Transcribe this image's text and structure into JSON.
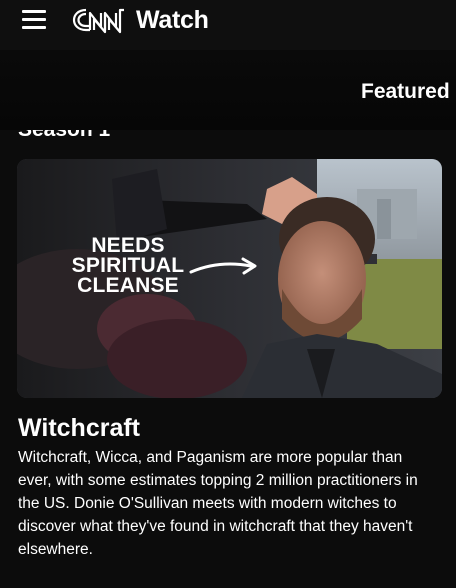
{
  "header": {
    "brand_logo": "CNN",
    "brand_suffix": "Watch",
    "menu_icon": "hamburger-menu-icon"
  },
  "subnav": {
    "active_tab": "Featured"
  },
  "main": {
    "season_heading": "Season 1",
    "hero": {
      "overlay_lines": [
        "NEEDS",
        "SPIRITUAL",
        "CLEANSE"
      ],
      "arrow_icon": "arrow-right-icon"
    },
    "episode_title": "Witchcraft",
    "episode_description": "Witchcraft, Wicca, and Paganism are more popular than ever, with some estimates topping 2 million practitioners in the US. Donie O'Sullivan meets with modern witches to discover what they've found in witchcraft that they haven't elsewhere."
  },
  "colors": {
    "background": "#0c0c0c",
    "text": "#ffffff"
  }
}
